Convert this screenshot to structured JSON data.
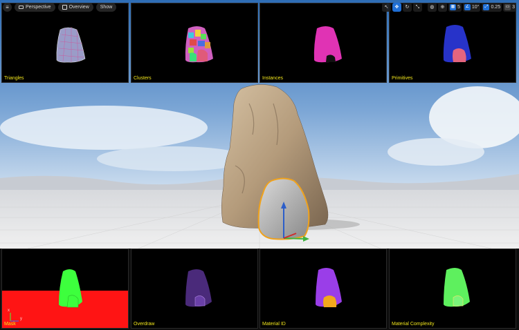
{
  "toolbar": {
    "perspective_label": "Perspective",
    "overview_label": "Overview",
    "show_label": "Show",
    "grid_snap_value": "5",
    "rotation_snap_value": "10°",
    "scale_snap_value": "0.25",
    "camera_speed_value": "3"
  },
  "panels": {
    "triangles": "Triangles",
    "clusters": "Clusters",
    "instances": "Instances",
    "primitives": "Primitives",
    "mask": "Mask",
    "overdraw": "Overdraw",
    "material_id": "Material ID",
    "material_complexity": "Material Complexity"
  },
  "axis": {
    "x": "x",
    "y": "y"
  },
  "colors": {
    "label_yellow": "#f2e61c",
    "selection_outline": "#f0a21c",
    "active_blue": "#1f6fd6"
  }
}
